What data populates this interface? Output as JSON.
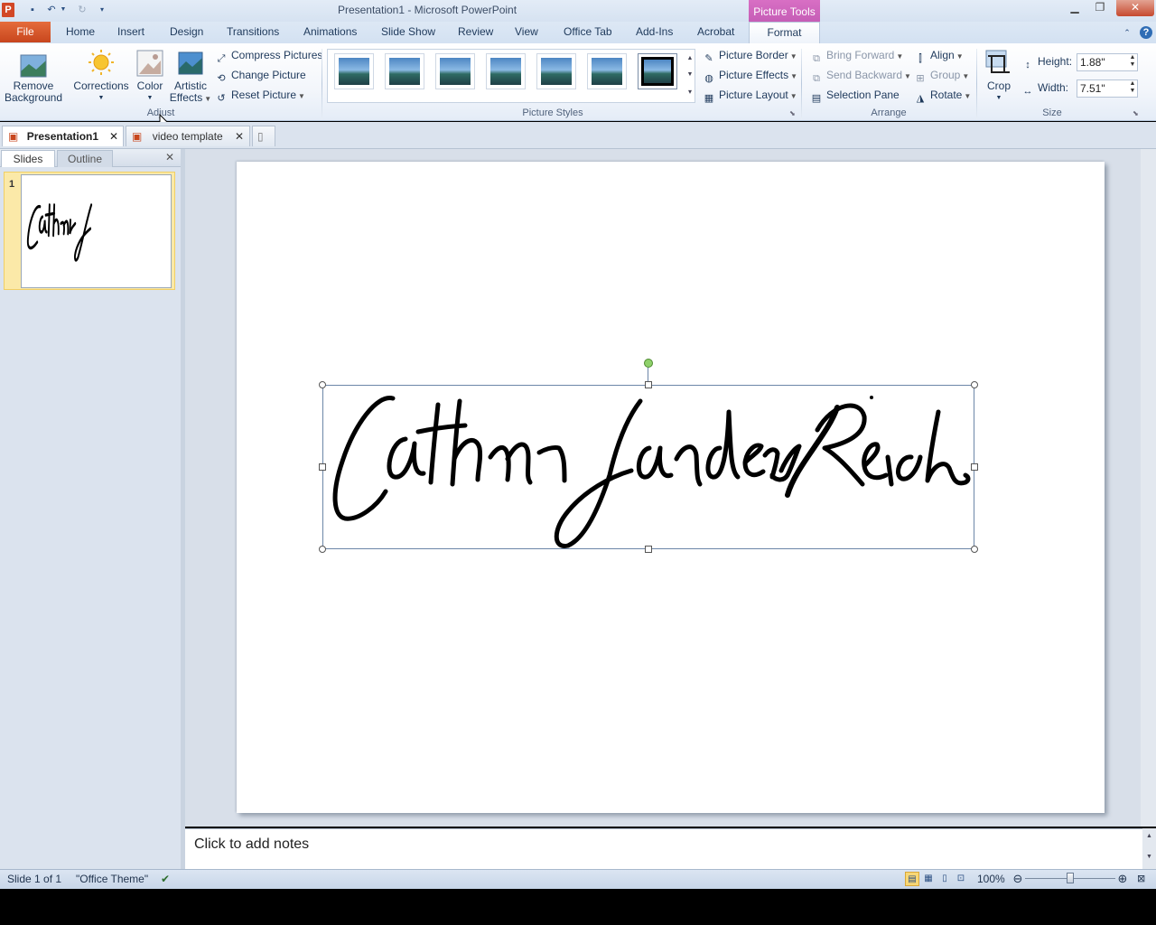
{
  "window": {
    "title": "Presentation1  -  Microsoft PowerPoint",
    "app_icon": "P",
    "context_tab_group": "Picture Tools",
    "controls": [
      "minimize-icon",
      "restore-icon",
      "close-icon"
    ]
  },
  "quick_access": [
    "save-icon",
    "undo-icon",
    "redo-icon",
    "customize-icon"
  ],
  "tabs": {
    "file": "File",
    "items": [
      "Home",
      "Insert",
      "Design",
      "Transitions",
      "Animations",
      "Slide Show",
      "Review",
      "View",
      "Office Tab",
      "Add-Ins",
      "Acrobat"
    ],
    "active": "Format"
  },
  "ribbon": {
    "adjust": {
      "label": "Adjust",
      "remove_background": [
        "Remove",
        "Background"
      ],
      "corrections": "Corrections",
      "color": "Color",
      "artistic_effects": [
        "Artistic",
        "Effects"
      ],
      "compress": "Compress Pictures",
      "change": "Change Picture",
      "reset": "Reset Picture"
    },
    "picture_styles": {
      "label": "Picture Styles",
      "border": "Picture Border",
      "effects": "Picture Effects",
      "layout": "Picture Layout"
    },
    "arrange": {
      "label": "Arrange",
      "bring_forward": "Bring Forward",
      "send_backward": "Send Backward",
      "selection_pane": "Selection Pane",
      "align": "Align",
      "group": "Group",
      "rotate": "Rotate"
    },
    "size": {
      "label": "Size",
      "crop": "Crop",
      "height_label": "Height:",
      "height_value": "1.88\"",
      "width_label": "Width:",
      "width_value": "7.51\""
    }
  },
  "doc_tabs": [
    "Presentation1",
    "video template"
  ],
  "left_panel": {
    "tabs": [
      "Slides",
      "Outline"
    ],
    "slide_number": "1"
  },
  "notes_placeholder": "Click to add notes",
  "status": {
    "slide": "Slide 1 of 1",
    "theme": "\"Office Theme\"",
    "zoom": "100%"
  },
  "colors": {
    "file_tab": "#c8461d",
    "context_tab": "#c45cb5",
    "ribbon_text": "#1e395b"
  }
}
